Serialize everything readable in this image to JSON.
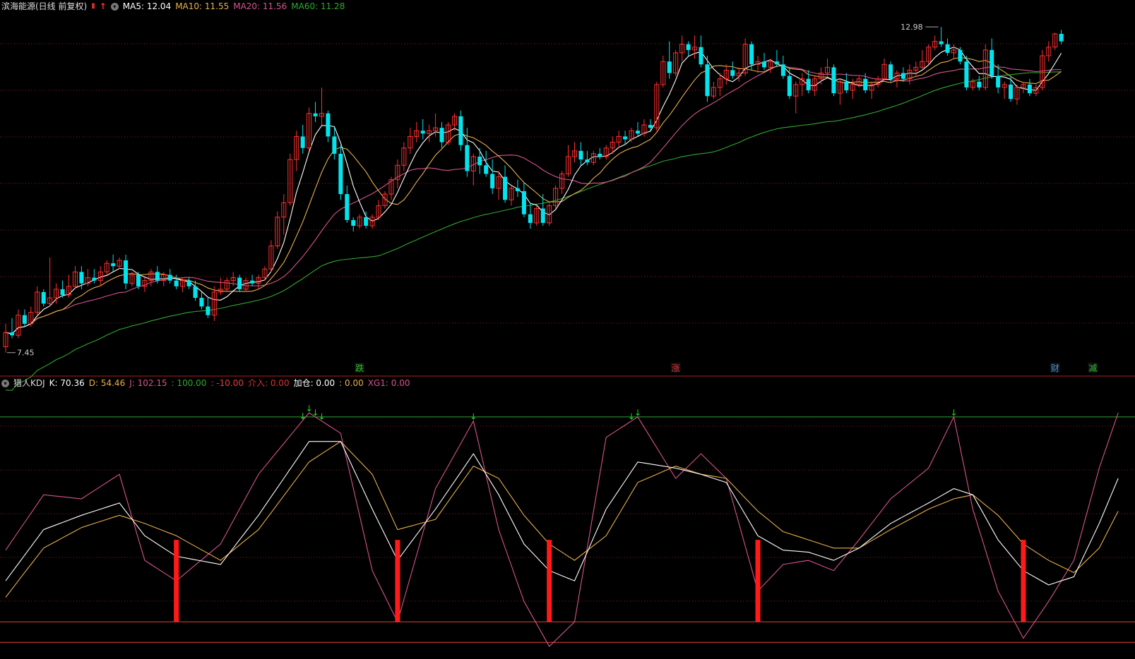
{
  "top_header": {
    "title": "滨海能源(日线 前复权)",
    "items": [
      {
        "key": "ma5",
        "label": "MA5: 12.04",
        "color": "#ffffff"
      },
      {
        "key": "ma10",
        "label": "MA10: 11.55",
        "color": "#e8b04a"
      },
      {
        "key": "ma20",
        "label": "MA20: 11.56",
        "color": "#d9538f"
      },
      {
        "key": "ma60",
        "label": "MA60: 11.28",
        "color": "#2fa82f"
      }
    ]
  },
  "bottom_header": {
    "title": "猎人KDJ",
    "items": [
      {
        "key": "k",
        "label": "K: 70.36",
        "color": "#ffffff"
      },
      {
        "key": "d",
        "label": "D: 54.46",
        "color": "#e8b04a"
      },
      {
        "key": "j",
        "label": "J: 102.15",
        "color": "#d9538f"
      },
      {
        "key": "h1",
        "label": ": 100.00",
        "color": "#2fa82f"
      },
      {
        "key": "h2",
        "label": ": -10.00",
        "color": "#e04040"
      },
      {
        "key": "in",
        "label": "介入: 0.00",
        "color": "#e03030"
      },
      {
        "key": "add",
        "label": "加仓: 0.00",
        "color": "#ffffff"
      },
      {
        "key": "z",
        "label": ": 0.00",
        "color": "#e8b04a"
      },
      {
        "key": "xg1",
        "label": "XG1: 0.00",
        "color": "#d9538f"
      }
    ]
  },
  "price_labels": {
    "high": "12.98",
    "low": "7.45"
  },
  "events": [
    {
      "text": "跌",
      "color": "#2fbf2f",
      "index": 56
    },
    {
      "text": "涨",
      "color": "#e03030",
      "index": 106
    },
    {
      "text": "财",
      "color": "#4a90e2",
      "index": 166
    },
    {
      "text": "减",
      "color": "#2fbf2f",
      "index": 172
    }
  ],
  "colors": {
    "up": "#ff3030",
    "down": "#00e5ee",
    "grid": "#8b1a1a",
    "ma5": "#ffffff",
    "ma10": "#e8b04a",
    "ma20": "#d9538f",
    "ma60": "#2fa82f"
  },
  "chart_data": [
    {
      "type": "candlestick",
      "title": "滨海能源(日线 前复权)",
      "ylim": [
        7.3,
        13.2
      ],
      "ohlc": [
        [
          7.55,
          7.95,
          7.45,
          7.8
        ],
        [
          7.8,
          8.05,
          7.7,
          7.75
        ],
        [
          7.75,
          8.2,
          7.7,
          8.1
        ],
        [
          8.1,
          8.2,
          7.9,
          7.95
        ],
        [
          7.95,
          8.25,
          7.9,
          8.15
        ],
        [
          8.15,
          8.6,
          8.1,
          8.5
        ],
        [
          8.5,
          8.55,
          8.25,
          8.3
        ],
        [
          8.3,
          9.1,
          8.25,
          8.4
        ],
        [
          8.4,
          8.65,
          8.3,
          8.55
        ],
        [
          8.55,
          8.7,
          8.4,
          8.45
        ],
        [
          8.45,
          8.8,
          8.4,
          8.6
        ],
        [
          8.6,
          8.95,
          8.55,
          8.85
        ],
        [
          8.85,
          8.95,
          8.55,
          8.65
        ],
        [
          8.65,
          8.9,
          8.6,
          8.75
        ],
        [
          8.75,
          8.9,
          8.65,
          8.7
        ],
        [
          8.7,
          8.95,
          8.6,
          8.85
        ],
        [
          8.85,
          9.05,
          8.8,
          9.0
        ],
        [
          9.0,
          9.15,
          8.85,
          8.95
        ],
        [
          8.95,
          9.1,
          8.9,
          9.05
        ],
        [
          9.05,
          9.15,
          8.55,
          8.65
        ],
        [
          8.65,
          8.85,
          8.6,
          8.8
        ],
        [
          8.8,
          8.85,
          8.55,
          8.6
        ],
        [
          8.6,
          8.75,
          8.5,
          8.7
        ],
        [
          8.7,
          8.9,
          8.6,
          8.85
        ],
        [
          8.85,
          8.95,
          8.65,
          8.7
        ],
        [
          8.7,
          8.85,
          8.6,
          8.8
        ],
        [
          8.8,
          8.9,
          8.65,
          8.7
        ],
        [
          8.7,
          8.8,
          8.55,
          8.6
        ],
        [
          8.6,
          8.75,
          8.5,
          8.7
        ],
        [
          8.7,
          8.75,
          8.55,
          8.6
        ],
        [
          8.6,
          8.7,
          8.35,
          8.4
        ],
        [
          8.4,
          8.5,
          8.2,
          8.25
        ],
        [
          8.25,
          8.4,
          8.05,
          8.1
        ],
        [
          8.1,
          8.6,
          8.0,
          8.5
        ],
        [
          8.5,
          8.75,
          8.45,
          8.55
        ],
        [
          8.55,
          8.75,
          8.5,
          8.7
        ],
        [
          8.7,
          8.85,
          8.6,
          8.75
        ],
        [
          8.75,
          8.8,
          8.5,
          8.55
        ],
        [
          8.55,
          8.75,
          8.5,
          8.7
        ],
        [
          8.7,
          8.8,
          8.6,
          8.65
        ],
        [
          8.65,
          8.8,
          8.55,
          8.75
        ],
        [
          8.75,
          8.95,
          8.7,
          8.9
        ],
        [
          8.9,
          9.4,
          8.85,
          9.3
        ],
        [
          9.3,
          9.9,
          9.25,
          9.8
        ],
        [
          9.8,
          10.2,
          9.5,
          10.05
        ],
        [
          10.05,
          10.9,
          10.0,
          10.8
        ],
        [
          10.8,
          11.3,
          10.6,
          11.2
        ],
        [
          11.2,
          11.4,
          10.9,
          11.0
        ],
        [
          11.0,
          11.7,
          10.95,
          11.6
        ],
        [
          11.6,
          11.8,
          11.45,
          11.55
        ],
        [
          11.55,
          12.05,
          11.4,
          11.6
        ],
        [
          11.6,
          11.65,
          11.1,
          11.2
        ],
        [
          11.2,
          11.35,
          10.8,
          10.9
        ],
        [
          10.9,
          11.05,
          10.1,
          10.2
        ],
        [
          10.2,
          10.35,
          9.7,
          9.75
        ],
        [
          9.75,
          9.8,
          9.55,
          9.65
        ],
        [
          9.65,
          9.85,
          9.6,
          9.8
        ],
        [
          9.8,
          9.9,
          9.6,
          9.65
        ],
        [
          9.65,
          9.85,
          9.6,
          9.8
        ],
        [
          9.8,
          10.1,
          9.75,
          10.0
        ],
        [
          10.0,
          10.25,
          9.95,
          10.2
        ],
        [
          10.2,
          10.5,
          10.1,
          10.45
        ],
        [
          10.45,
          10.8,
          10.3,
          10.7
        ],
        [
          10.7,
          11.1,
          10.6,
          11.0
        ],
        [
          11.0,
          11.35,
          10.9,
          11.2
        ],
        [
          11.2,
          11.45,
          11.1,
          11.3
        ],
        [
          11.3,
          11.5,
          11.15,
          11.25
        ],
        [
          11.25,
          11.4,
          11.1,
          11.3
        ],
        [
          11.3,
          11.6,
          11.2,
          11.35
        ],
        [
          11.35,
          11.45,
          11.0,
          11.1
        ],
        [
          11.1,
          11.45,
          11.05,
          11.4
        ],
        [
          11.4,
          11.6,
          11.3,
          11.55
        ],
        [
          11.55,
          11.65,
          10.95,
          11.05
        ],
        [
          11.05,
          11.35,
          10.5,
          10.6
        ],
        [
          10.6,
          10.9,
          10.35,
          10.85
        ],
        [
          10.85,
          11.0,
          10.55,
          10.7
        ],
        [
          10.7,
          10.95,
          10.5,
          10.55
        ],
        [
          10.55,
          10.8,
          10.2,
          10.3
        ],
        [
          10.3,
          10.6,
          10.1,
          10.5
        ],
        [
          10.5,
          10.7,
          10.05,
          10.1
        ],
        [
          10.1,
          10.35,
          10.0,
          10.3
        ],
        [
          10.3,
          10.45,
          10.15,
          10.25
        ],
        [
          10.25,
          10.4,
          9.8,
          9.85
        ],
        [
          9.85,
          10.05,
          9.6,
          9.7
        ],
        [
          9.7,
          10.0,
          9.65,
          9.95
        ],
        [
          9.95,
          10.2,
          9.65,
          9.7
        ],
        [
          9.7,
          10.05,
          9.65,
          10.0
        ],
        [
          10.0,
          10.35,
          9.95,
          10.3
        ],
        [
          10.3,
          10.6,
          10.2,
          10.55
        ],
        [
          10.55,
          11.05,
          10.5,
          10.85
        ],
        [
          10.85,
          11.1,
          10.75,
          10.95
        ],
        [
          10.95,
          11.1,
          10.7,
          10.8
        ],
        [
          10.8,
          10.95,
          10.7,
          10.75
        ],
        [
          10.75,
          10.95,
          10.7,
          10.9
        ],
        [
          10.9,
          11.0,
          10.8,
          10.85
        ],
        [
          10.85,
          11.05,
          10.8,
          11.0
        ],
        [
          11.0,
          11.2,
          10.9,
          11.1
        ],
        [
          11.1,
          11.3,
          11.0,
          11.2
        ],
        [
          11.2,
          11.3,
          11.05,
          11.15
        ],
        [
          11.15,
          11.35,
          11.1,
          11.3
        ],
        [
          11.3,
          11.45,
          11.2,
          11.25
        ],
        [
          11.25,
          11.5,
          11.2,
          11.4
        ],
        [
          11.4,
          11.5,
          11.3,
          11.35
        ],
        [
          11.35,
          12.15,
          11.3,
          12.1
        ],
        [
          12.1,
          12.6,
          12.05,
          12.5
        ],
        [
          12.5,
          12.85,
          12.2,
          12.3
        ],
        [
          12.3,
          12.7,
          12.25,
          12.65
        ],
        [
          12.65,
          12.95,
          12.5,
          12.8
        ],
        [
          12.8,
          12.85,
          12.6,
          12.7
        ],
        [
          12.7,
          12.95,
          12.55,
          12.75
        ],
        [
          12.75,
          12.95,
          12.4,
          12.45
        ],
        [
          12.45,
          12.6,
          11.8,
          11.9
        ],
        [
          11.9,
          12.15,
          11.85,
          12.05
        ],
        [
          12.05,
          12.3,
          11.9,
          12.2
        ],
        [
          12.2,
          12.45,
          12.1,
          12.35
        ],
        [
          12.35,
          12.5,
          12.2,
          12.25
        ],
        [
          12.25,
          12.4,
          12.15,
          12.3
        ],
        [
          12.3,
          12.9,
          12.25,
          12.8
        ],
        [
          12.8,
          12.85,
          12.35,
          12.45
        ],
        [
          12.45,
          12.6,
          12.3,
          12.5
        ],
        [
          12.5,
          12.65,
          12.35,
          12.4
        ],
        [
          12.4,
          12.55,
          12.3,
          12.5
        ],
        [
          12.5,
          12.7,
          12.4,
          12.45
        ],
        [
          12.45,
          12.6,
          12.2,
          12.25
        ],
        [
          12.25,
          12.4,
          11.85,
          11.9
        ],
        [
          11.9,
          12.15,
          11.6,
          12.1
        ],
        [
          12.1,
          12.3,
          11.9,
          12.2
        ],
        [
          12.2,
          12.35,
          11.95,
          12.0
        ],
        [
          12.0,
          12.25,
          11.9,
          12.2
        ],
        [
          12.2,
          12.4,
          12.1,
          12.3
        ],
        [
          12.3,
          12.55,
          12.25,
          12.4
        ],
        [
          12.4,
          12.45,
          11.9,
          11.95
        ],
        [
          11.95,
          12.2,
          11.75,
          12.15
        ],
        [
          12.15,
          12.3,
          11.95,
          12.0
        ],
        [
          12.0,
          12.2,
          11.85,
          12.1
        ],
        [
          12.1,
          12.25,
          12.05,
          12.2
        ],
        [
          12.2,
          12.3,
          11.95,
          12.0
        ],
        [
          12.0,
          12.15,
          11.85,
          12.1
        ],
        [
          12.1,
          12.25,
          12.05,
          12.2
        ],
        [
          12.2,
          12.55,
          12.15,
          12.45
        ],
        [
          12.45,
          12.5,
          12.15,
          12.2
        ],
        [
          12.2,
          12.35,
          12.05,
          12.3
        ],
        [
          12.3,
          12.4,
          12.15,
          12.2
        ],
        [
          12.2,
          12.45,
          12.1,
          12.35
        ],
        [
          12.35,
          12.5,
          12.25,
          12.4
        ],
        [
          12.4,
          12.7,
          12.35,
          12.5
        ],
        [
          12.5,
          12.8,
          12.45,
          12.75
        ],
        [
          12.75,
          12.95,
          12.7,
          12.85
        ],
        [
          12.85,
          13.1,
          12.75,
          12.8
        ],
        [
          12.8,
          12.9,
          12.6,
          12.65
        ],
        [
          12.65,
          12.8,
          12.55,
          12.7
        ],
        [
          12.7,
          12.75,
          12.45,
          12.5
        ],
        [
          12.5,
          12.6,
          12.0,
          12.05
        ],
        [
          12.05,
          12.2,
          12.0,
          12.15
        ],
        [
          12.15,
          12.25,
          12.0,
          12.05
        ],
        [
          12.05,
          12.8,
          12.0,
          12.7
        ],
        [
          12.7,
          12.9,
          12.2,
          12.25
        ],
        [
          12.25,
          12.45,
          11.95,
          12.05
        ],
        [
          12.05,
          12.15,
          11.85,
          12.1
        ],
        [
          12.1,
          12.25,
          11.8,
          11.85
        ],
        [
          11.85,
          12.1,
          11.75,
          12.05
        ],
        [
          12.05,
          12.15,
          11.95,
          12.1
        ],
        [
          12.1,
          12.2,
          11.9,
          11.95
        ],
        [
          11.95,
          12.1,
          11.9,
          12.05
        ],
        [
          12.05,
          12.7,
          12.0,
          12.6
        ],
        [
          12.6,
          12.85,
          12.5,
          12.75
        ],
        [
          12.75,
          13.0,
          12.7,
          12.98
        ],
        [
          12.98,
          13.05,
          12.8,
          12.85
        ]
      ]
    },
    {
      "type": "line",
      "title": "猎人KDJ",
      "ylim": [
        -14,
        112
      ],
      "series_names": [
        "K",
        "D",
        "J"
      ],
      "h_lines": [
        100,
        0,
        -10
      ],
      "anchors": [
        [
          0,
          20,
          12,
          35
        ],
        [
          6,
          45,
          36,
          62
        ],
        [
          12,
          52,
          46,
          60
        ],
        [
          18,
          58,
          52,
          72
        ],
        [
          22,
          42,
          48,
          30
        ],
        [
          27,
          32,
          42,
          20
        ],
        [
          34,
          28,
          30,
          38
        ],
        [
          40,
          52,
          45,
          72
        ],
        [
          48,
          88,
          78,
          102
        ],
        [
          53,
          88,
          88,
          92
        ],
        [
          58,
          55,
          72,
          25
        ],
        [
          62,
          30,
          45,
          0
        ],
        [
          68,
          55,
          50,
          65
        ],
        [
          74,
          82,
          76,
          98
        ],
        [
          78,
          62,
          70,
          45
        ],
        [
          82,
          38,
          52,
          10
        ],
        [
          86,
          25,
          38,
          -12
        ],
        [
          90,
          20,
          30,
          0
        ],
        [
          95,
          55,
          42,
          90
        ],
        [
          100,
          78,
          68,
          100
        ],
        [
          106,
          75,
          76,
          70
        ],
        [
          110,
          72,
          72,
          82
        ],
        [
          114,
          68,
          70,
          70
        ],
        [
          119,
          42,
          54,
          15
        ],
        [
          123,
          35,
          44,
          28
        ],
        [
          127,
          34,
          40,
          30
        ],
        [
          131,
          30,
          36,
          25
        ],
        [
          135,
          36,
          36,
          40
        ],
        [
          140,
          48,
          45,
          60
        ],
        [
          146,
          58,
          55,
          75
        ],
        [
          150,
          65,
          60,
          100
        ],
        [
          153,
          62,
          62,
          55
        ],
        [
          157,
          40,
          52,
          15
        ],
        [
          161,
          25,
          38,
          -8
        ],
        [
          165,
          18,
          30,
          10
        ],
        [
          169,
          22,
          24,
          30
        ],
        [
          173,
          48,
          36,
          75
        ],
        [
          176,
          70,
          54,
          102
        ]
      ]
    }
  ]
}
